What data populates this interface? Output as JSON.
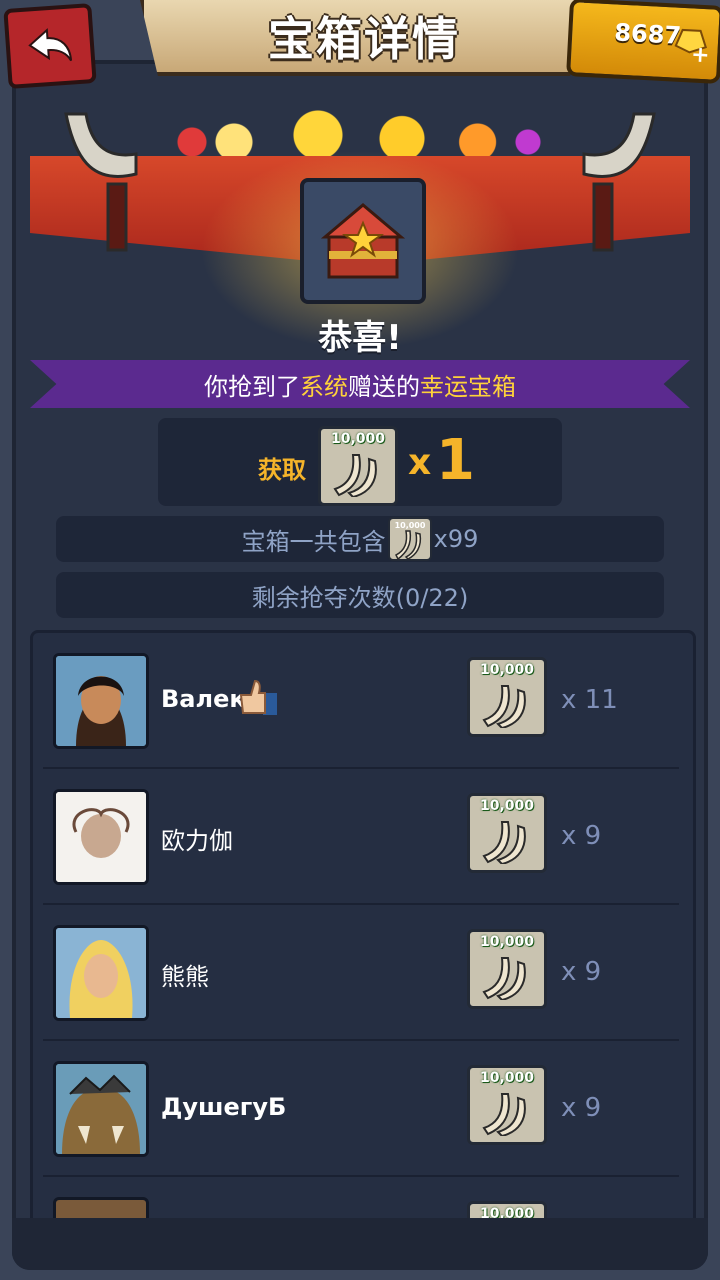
{
  "header": {
    "back_label": "",
    "title": "宝箱详情",
    "gold_amount": "8687",
    "gold_plus": "+"
  },
  "chest": {
    "congrats": "恭喜!",
    "ribbon_part1": "你抢到了",
    "ribbon_hl1": "系统",
    "ribbon_part2": "赠送的",
    "ribbon_hl2": "幸运宝箱",
    "obtain_label": "获取",
    "obtain_x": "x",
    "obtain_qty": "1",
    "item_amount": "10,000",
    "contains_label": "宝箱一共包含",
    "contains_qty": "x99",
    "remaining_label": "剩余抢夺次数(0/22)"
  },
  "players": [
    {
      "name": "Валек",
      "qty": "x 11",
      "item_amount": "10,000",
      "liked": true
    },
    {
      "name": "欧力伽",
      "qty": "x 9",
      "item_amount": "10,000",
      "liked": false
    },
    {
      "name": "熊熊",
      "qty": "x 9",
      "item_amount": "10,000",
      "liked": false
    },
    {
      "name": "ДушегуБ",
      "qty": "x 9",
      "item_amount": "10,000",
      "liked": false
    },
    {
      "name": "",
      "qty": "",
      "item_amount": "10,000",
      "liked": false
    }
  ],
  "colors": {
    "accent_gold": "#f5b42a",
    "ribbon_purple": "#5b2a8f",
    "panel_dark": "#1e2638"
  }
}
